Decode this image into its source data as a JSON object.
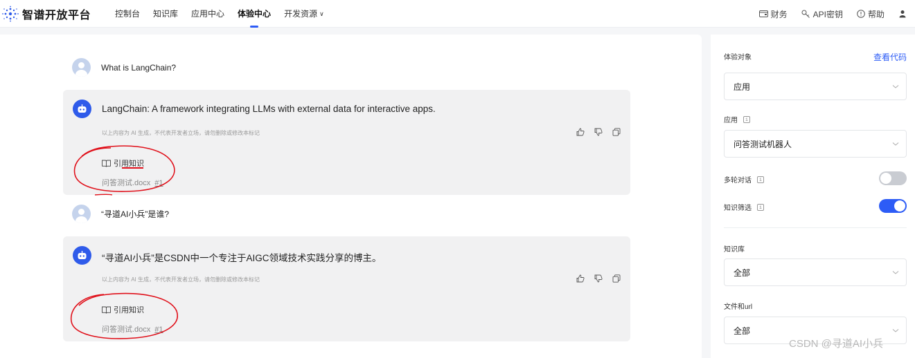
{
  "brand": {
    "name": "智谱开放平台"
  },
  "nav": {
    "items": [
      {
        "label": "控制台"
      },
      {
        "label": "知识库"
      },
      {
        "label": "应用中心"
      },
      {
        "label": "体验中心",
        "active": true
      },
      {
        "label": "开发资源",
        "has_dropdown": true
      }
    ],
    "right": {
      "finance": "财务",
      "api_key": "API密钥",
      "help": "帮助"
    }
  },
  "chat": {
    "messages": [
      {
        "role": "user",
        "text": "What is LangChain?"
      },
      {
        "role": "assistant",
        "text": "LangChain: A framework integrating LLMs with external data for interactive apps.",
        "disclaimer": "以上内容为 AI 生成，不代表开发者立场，请勿删除或修改本标记",
        "reference_title": "引用知识",
        "reference_file": "问答测试.docx",
        "reference_index": "#1"
      },
      {
        "role": "user",
        "text": "“寻道AI小兵”是谁?"
      },
      {
        "role": "assistant",
        "text": "“寻道AI小兵”是CSDN中一个专注于AIGC领域技术实践分享的博主。",
        "disclaimer": "以上内容为 AI 生成，不代表开发者立场，请勿删除或修改本标记",
        "reference_title": "引用知识",
        "reference_file": "问答测试.docx",
        "reference_index": "#1"
      }
    ]
  },
  "settings": {
    "target_label": "体验对象",
    "view_code": "查看代码",
    "target_value": "应用",
    "app_label": "应用",
    "app_value": "问答测试机器人",
    "multi_turn_label": "多轮对话",
    "multi_turn_on": false,
    "knowledge_filter_label": "知识筛选",
    "knowledge_filter_on": true,
    "kb_label": "知识库",
    "kb_value": "全部",
    "file_url_label": "文件和url",
    "file_url_value": "全部"
  },
  "watermark": "CSDN @寻道AI小兵",
  "colors": {
    "accent": "#2d5cf6",
    "annotation": "#e0101a"
  }
}
